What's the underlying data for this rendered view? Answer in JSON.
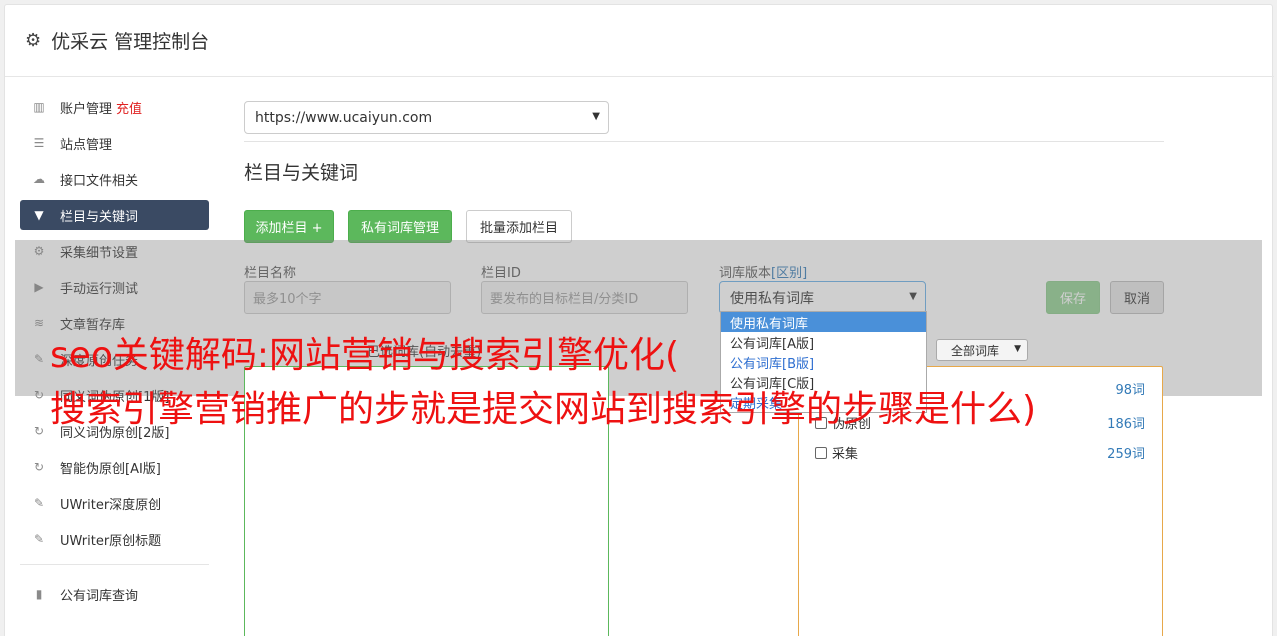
{
  "header": {
    "title": "优采云 管理控制台"
  },
  "sidebar": {
    "items": [
      {
        "label": "账户管理",
        "extra": "充值"
      },
      {
        "label": "站点管理"
      },
      {
        "label": "接口文件相关"
      },
      {
        "label": "栏目与关键词"
      },
      {
        "label": "采集细节设置"
      },
      {
        "label": "手动运行测试"
      },
      {
        "label": "文章暂存库"
      },
      {
        "label": "深度原创任务"
      },
      {
        "label": "同义词伪原创[1版]"
      },
      {
        "label": "同义词伪原创[2版]"
      },
      {
        "label": "智能伪原创[AI版]"
      },
      {
        "label": "UWriter深度原创"
      },
      {
        "label": "UWriter原创标题"
      },
      {
        "label": "公有词库查询"
      }
    ]
  },
  "site_select": {
    "value": "https://www.ucaiyun.com"
  },
  "section": {
    "title": "栏目与关键词"
  },
  "toolbar": {
    "add_column": "添加栏目 +",
    "private_lib": "私有词库管理",
    "batch_add": "批量添加栏目"
  },
  "form": {
    "name_label": "栏目名称",
    "name_placeholder": "最多10个字",
    "id_label": "栏目ID",
    "id_placeholder": "要发布的目标栏目/分类ID",
    "version_label": "词库版本",
    "version_link": "[区别]",
    "version_value": "使用私有词库",
    "save": "保存",
    "cancel": "取消"
  },
  "dropdown": {
    "options": [
      "使用私有词库",
      "公有词库[A版]",
      "公有词库[B版]",
      "公有词库[C版]",
      "定期采集"
    ]
  },
  "filter": {
    "label": "已选词库(自动去重)",
    "select_value": "全部词库"
  },
  "library": {
    "rows": [
      {
        "label": "",
        "count": "98词"
      },
      {
        "label": "伪原创",
        "count": "186词"
      },
      {
        "label": "采集",
        "count": "259词"
      }
    ]
  },
  "watermark": {
    "line1": "seo关键解码:网站营销与搜索引擎优化(",
    "line2": "搜索引擎营销推广的步就是提交网站到搜索引擎的步骤是什么)"
  },
  "colors": {
    "accent_green": "#5cb85c",
    "sidebar_active": "#3a4a63",
    "watermark": "#ee1111"
  }
}
